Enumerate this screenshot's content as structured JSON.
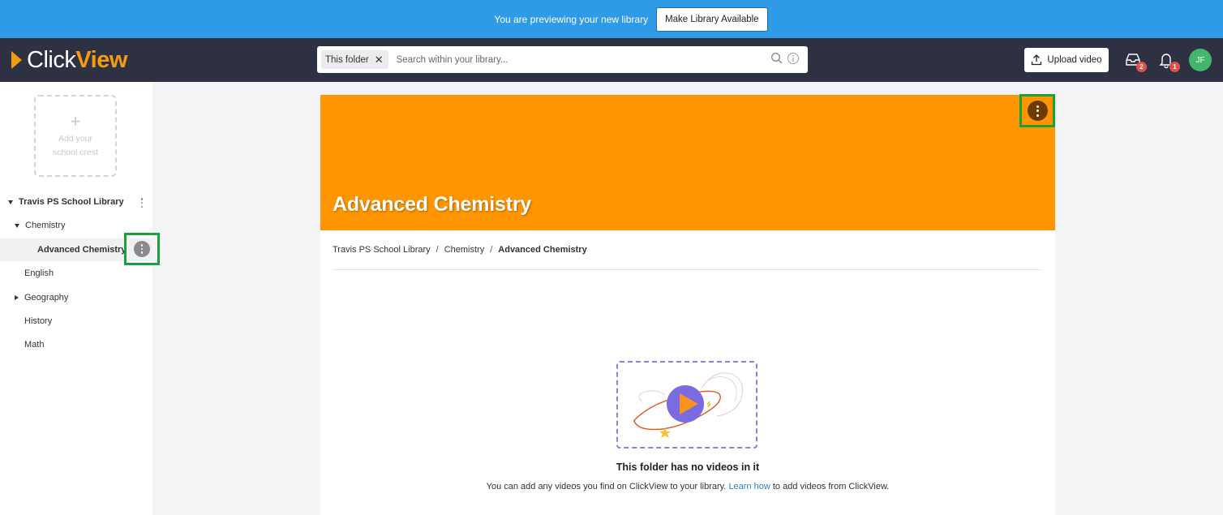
{
  "banner": {
    "text": "You are previewing your new library",
    "button_label": "Make Library Available"
  },
  "header": {
    "logo_part1": "Click",
    "logo_part2": "View",
    "search_chip": "This folder",
    "search_placeholder": "Search within your library...",
    "upload_label": "Upload video",
    "inbox_badge": "2",
    "notifications_badge": "1",
    "avatar_initials": "JF"
  },
  "sidebar": {
    "crest_line1": "Add your",
    "crest_line2": "school crest",
    "root": "Travis PS School Library",
    "items": [
      {
        "label": "Chemistry"
      },
      {
        "label": "Advanced Chemistry"
      },
      {
        "label": "English"
      },
      {
        "label": "Geography"
      },
      {
        "label": "History"
      },
      {
        "label": "Math"
      }
    ]
  },
  "folder": {
    "title": "Advanced Chemistry",
    "hero_color": "#ff9500",
    "breadcrumb": [
      "Travis PS School Library",
      "Chemistry",
      "Advanced Chemistry"
    ],
    "empty_title": "This folder has no videos in it",
    "empty_text_before": "You can add any videos you find on ClickView to your library.",
    "empty_link": "Learn how",
    "empty_text_after": "to add videos from ClickView."
  }
}
